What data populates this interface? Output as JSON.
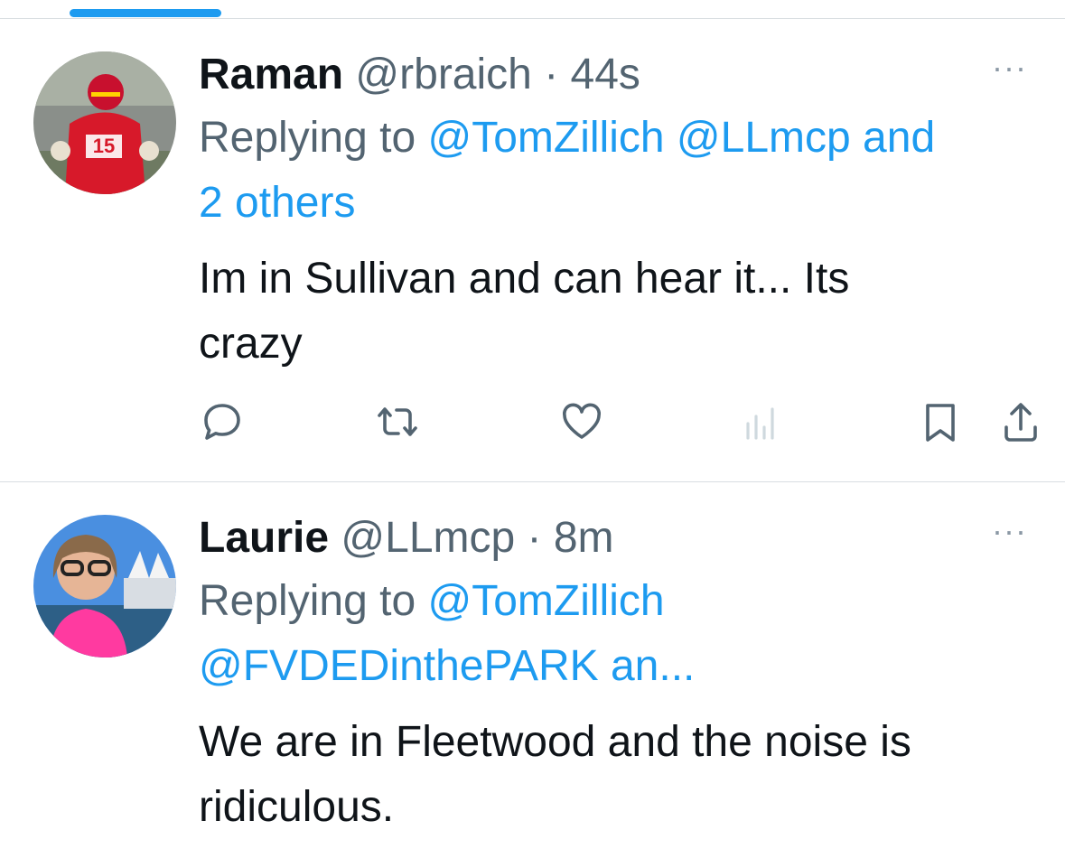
{
  "tweets": [
    {
      "name": "Raman",
      "handle": "@rbraich",
      "separator": "·",
      "time": "44s",
      "more": "···",
      "replying_prefix": "Replying to",
      "mentions": [
        "@TomZillich",
        "@LLmcp",
        "and",
        "2 others"
      ],
      "text_line1": "Im in Sullivan and can hear it... Its",
      "text_line2": "crazy"
    },
    {
      "name": "Laurie",
      "handle": "@LLmcp",
      "separator": "·",
      "time": "8m",
      "more": "···",
      "replying_prefix": "Replying to",
      "mentions": [
        "@TomZillich",
        "@FVDEDinthePARK an..."
      ],
      "text_line1": "We are in Fleetwood and the noise is",
      "text_line2": "ridiculous."
    }
  ],
  "icons": [
    "reply-icon",
    "retweet-icon",
    "like-icon",
    "views-icon",
    "bookmark-icon",
    "share-icon"
  ],
  "colors": {
    "link": "#1d9bf0",
    "muted": "#536471",
    "text": "#0f1419",
    "accent": "#1d9bf0"
  }
}
